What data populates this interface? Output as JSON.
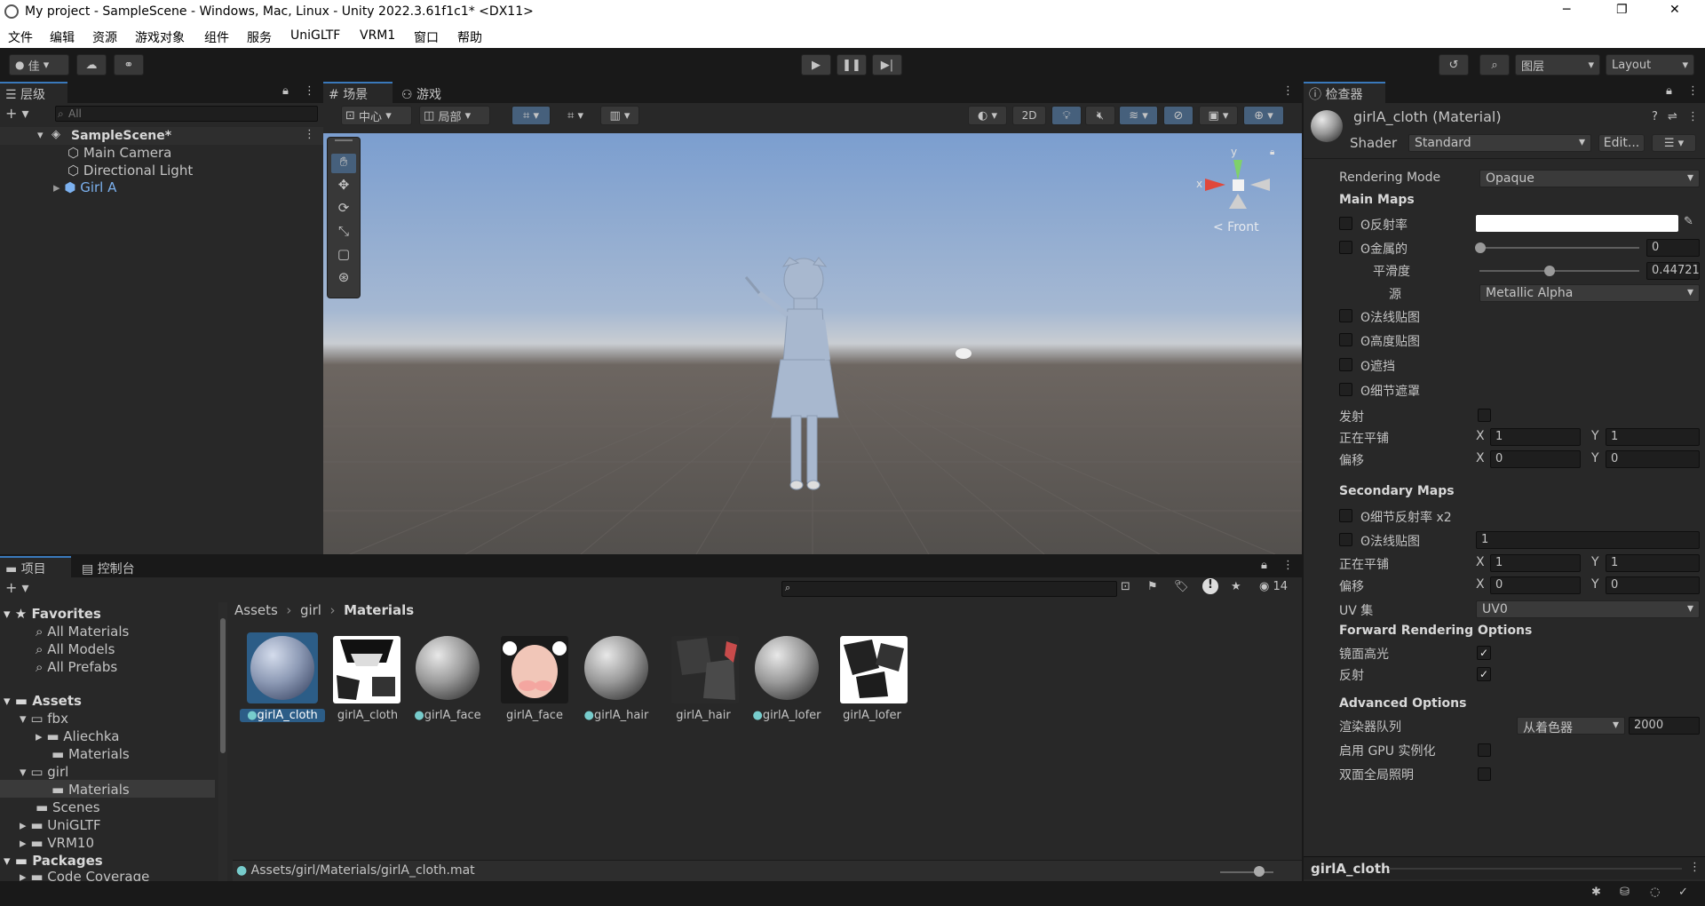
{
  "window": {
    "title": "My project - SampleScene - Windows, Mac, Linux - Unity 2022.3.61f1c1* <DX11>",
    "controls": [
      "─",
      "❐",
      "✕"
    ]
  },
  "menu": [
    "文件",
    "编辑",
    "资源",
    "游戏对象",
    "组件",
    "服务",
    "UniGLTF",
    "VRM1",
    "窗口",
    "帮助"
  ],
  "toolbar": {
    "account": "佳",
    "layers": "图层",
    "layout": "Layout"
  },
  "hierarchy": {
    "tab": "层级",
    "search_placeholder": "All",
    "scene": "SampleScene*",
    "items": [
      "Main Camera",
      "Directional Light",
      "Girl A"
    ]
  },
  "scene_view": {
    "tab_scene": "场景",
    "tab_game": "游戏",
    "pivot": "中心",
    "space": "局部",
    "mode_2d": "2D",
    "gizmo_front": "< Front",
    "gizmo_y": "y",
    "gizmo_x": "x"
  },
  "project": {
    "tab_project": "项目",
    "tab_console": "控制台",
    "hidden_count": "14",
    "favorites": "Favorites",
    "fav_items": [
      "All Materials",
      "All Models",
      "All Prefabs"
    ],
    "assets": "Assets",
    "tree": {
      "fbx": "fbx",
      "aliechka": "Aliechka",
      "fbx_materials": "Materials",
      "girl": "girl",
      "girl_materials": "Materials",
      "scenes": "Scenes",
      "uniglt": "UniGLTF",
      "vrm10": "VRM10"
    },
    "packages": "Packages",
    "code_coverage": "Code Coverage",
    "breadcrumb": [
      "Assets",
      "girl",
      "Materials"
    ],
    "grid_items": [
      "girlA_cloth",
      "girlA_cloth",
      "girlA_face",
      "girlA_face",
      "girlA_hair",
      "girlA_hair",
      "girlA_lofer",
      "girlA_lofer"
    ],
    "status_path": "Assets/girl/Materials/girlA_cloth.mat"
  },
  "inspector": {
    "tab": "检查器",
    "name": "girlA_cloth (Material)",
    "shader_label": "Shader",
    "shader_value": "Standard",
    "edit_button": "Edit...",
    "rendering_mode_label": "Rendering Mode",
    "rendering_mode_value": "Opaque",
    "main_maps": "Main Maps",
    "albedo": "反射率",
    "metallic": "金属的",
    "metallic_value": "0",
    "smoothness": "平滑度",
    "smoothness_value": "0.44721",
    "source": "源",
    "source_value": "Metallic Alpha",
    "normal_map": "法线贴图",
    "height_map": "高度贴图",
    "occlusion": "遮挡",
    "detail_mask": "细节遮罩",
    "emission": "发射",
    "tiling": "正在平铺",
    "offset": "偏移",
    "x": "X",
    "y": "Y",
    "tiling_x": "1",
    "tiling_y": "1",
    "offset_x": "0",
    "offset_y": "0",
    "secondary_maps": "Secondary Maps",
    "detail_albedo": "细节反射率 x2",
    "sec_normal_map": "法线贴图",
    "sec_normal_value": "1",
    "sec_tiling_x": "1",
    "sec_tiling_y": "1",
    "sec_offset_x": "0",
    "sec_offset_y": "0",
    "uv_set_label": "UV 集",
    "uv_set_value": "UV0",
    "forward_options": "Forward Rendering Options",
    "specular": "镜面高光",
    "reflections": "反射",
    "advanced": "Advanced Options",
    "render_queue": "渲染器队列",
    "render_queue_mode": "从着色器",
    "render_queue_value": "2000",
    "gpu_instancing": "启用 GPU 实例化",
    "double_sided_gi": "双面全局照明",
    "preview_name": "girlA_cloth"
  },
  "colors": {
    "accent": "#3a79bb",
    "selected": "#2c5d87",
    "sky": "#7a9fd2",
    "ground": "#4f4a47"
  }
}
